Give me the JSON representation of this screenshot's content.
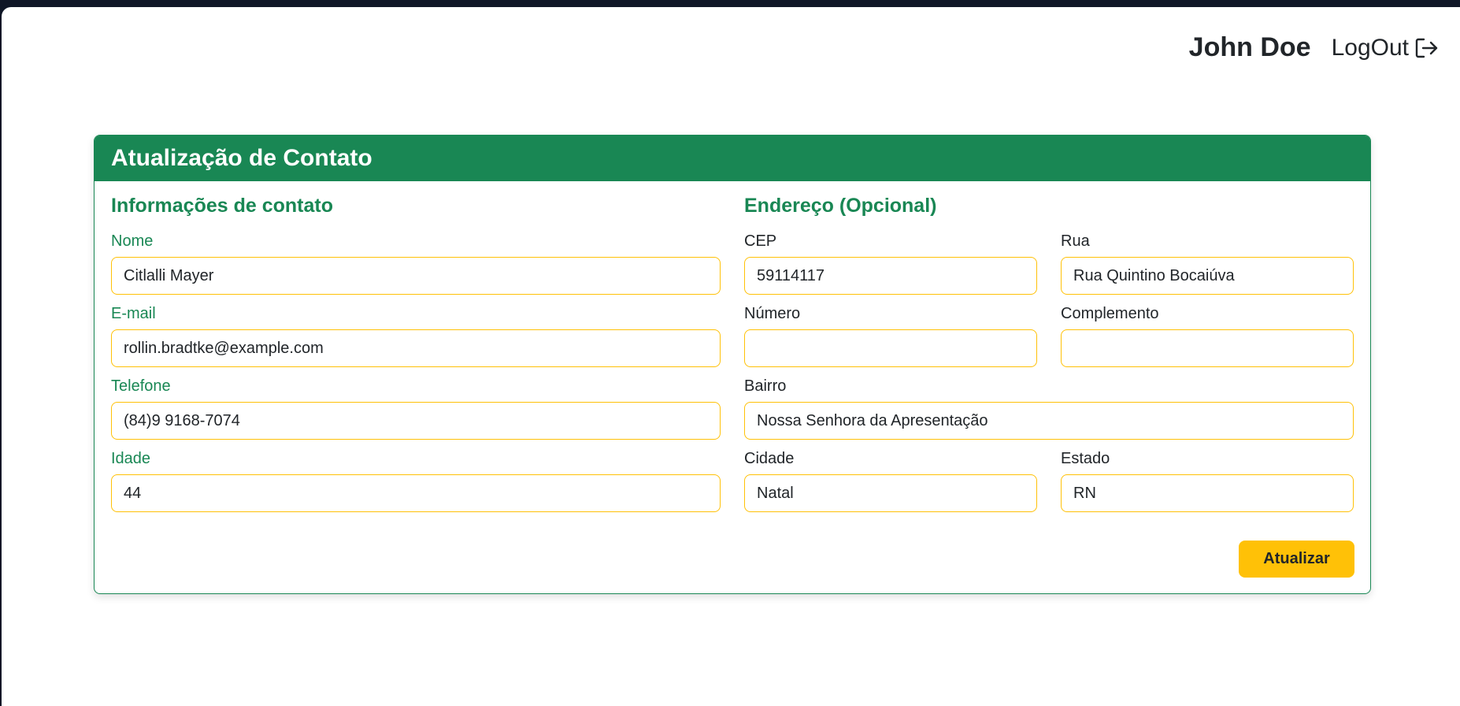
{
  "header": {
    "user_name": "John Doe",
    "logout_label": "LogOut",
    "logout_icon": "logout-icon"
  },
  "card": {
    "title": "Atualização de Contato",
    "contact_section": {
      "title": "Informações de contato",
      "fields": {
        "nome": {
          "label": "Nome",
          "value": "Citlalli Mayer"
        },
        "email": {
          "label": "E-mail",
          "value": "rollin.bradtke@example.com"
        },
        "telefone": {
          "label": "Telefone",
          "value": "(84)9 9168-7074"
        },
        "idade": {
          "label": "Idade",
          "value": "44"
        }
      }
    },
    "address_section": {
      "title": "Endereço (Opcional)",
      "fields": {
        "cep": {
          "label": "CEP",
          "value": "59114117"
        },
        "rua": {
          "label": "Rua",
          "value": "Rua Quintino Bocaiúva"
        },
        "numero": {
          "label": "Número",
          "value": ""
        },
        "complemento": {
          "label": "Complemento",
          "value": ""
        },
        "bairro": {
          "label": "Bairro",
          "value": "Nossa Senhora da Apresentação"
        },
        "cidade": {
          "label": "Cidade",
          "value": "Natal"
        },
        "estado": {
          "label": "Estado",
          "value": "RN"
        }
      }
    },
    "submit_label": "Atualizar"
  },
  "colors": {
    "primary_green": "#198754",
    "accent_yellow": "#ffc107",
    "text_dark": "#212529"
  }
}
